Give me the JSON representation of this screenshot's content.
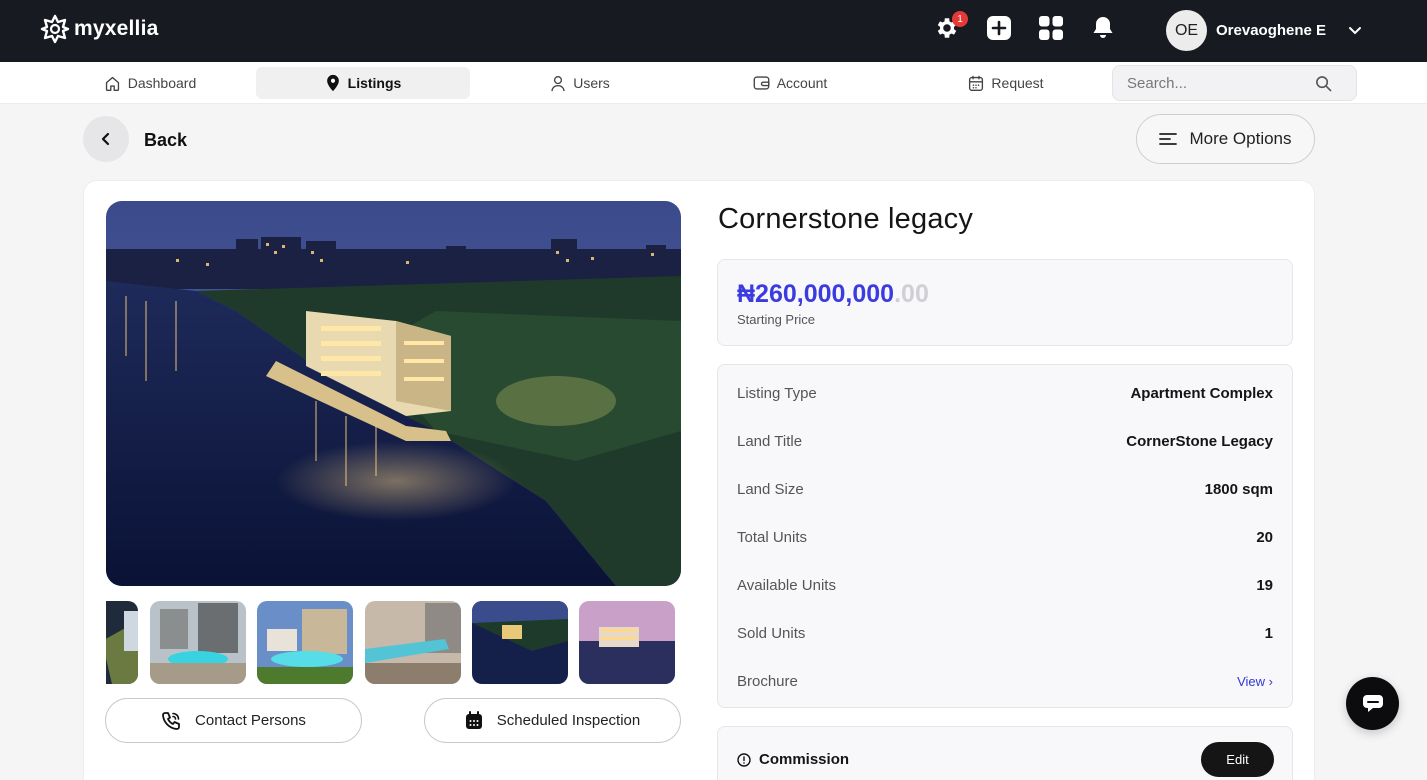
{
  "brand": {
    "name": "myxellia"
  },
  "topbar": {
    "notification_count": "1",
    "user_initials": "OE",
    "user_name": "Orevaoghene E"
  },
  "nav": {
    "items": [
      {
        "label": "Dashboard",
        "icon": "home-icon"
      },
      {
        "label": "Listings",
        "icon": "location-pin-icon",
        "active": true
      },
      {
        "label": "Users",
        "icon": "user-icon"
      },
      {
        "label": "Account",
        "icon": "wallet-icon"
      },
      {
        "label": "Request",
        "icon": "calendar-icon"
      }
    ],
    "search_placeholder": "Search..."
  },
  "page": {
    "back_label": "Back",
    "more_options_label": "More Options"
  },
  "listing": {
    "title": "Cornerstone legacy",
    "price_main": "₦260,000,000",
    "price_decimal": ".00",
    "price_label": "Starting Price",
    "details": [
      {
        "key": "Listing Type",
        "value": "Apartment Complex"
      },
      {
        "key": "Land Title",
        "value": "CornerStone Legacy"
      },
      {
        "key": "Land Size",
        "value": "1800 sqm"
      },
      {
        "key": "Total Units",
        "value": "20"
      },
      {
        "key": "Available Units",
        "value": "19"
      },
      {
        "key": "Sold Units",
        "value": "1"
      },
      {
        "key": "Brochure",
        "value": "View ›"
      }
    ],
    "contact_persons_label": "Contact Persons",
    "scheduled_inspection_label": "Scheduled Inspection",
    "commission_label": "Commission",
    "edit_label": "Edit"
  },
  "colors": {
    "topbar_bg": "#171a21",
    "price_accent": "#3b3be0",
    "link": "#3535d6"
  }
}
